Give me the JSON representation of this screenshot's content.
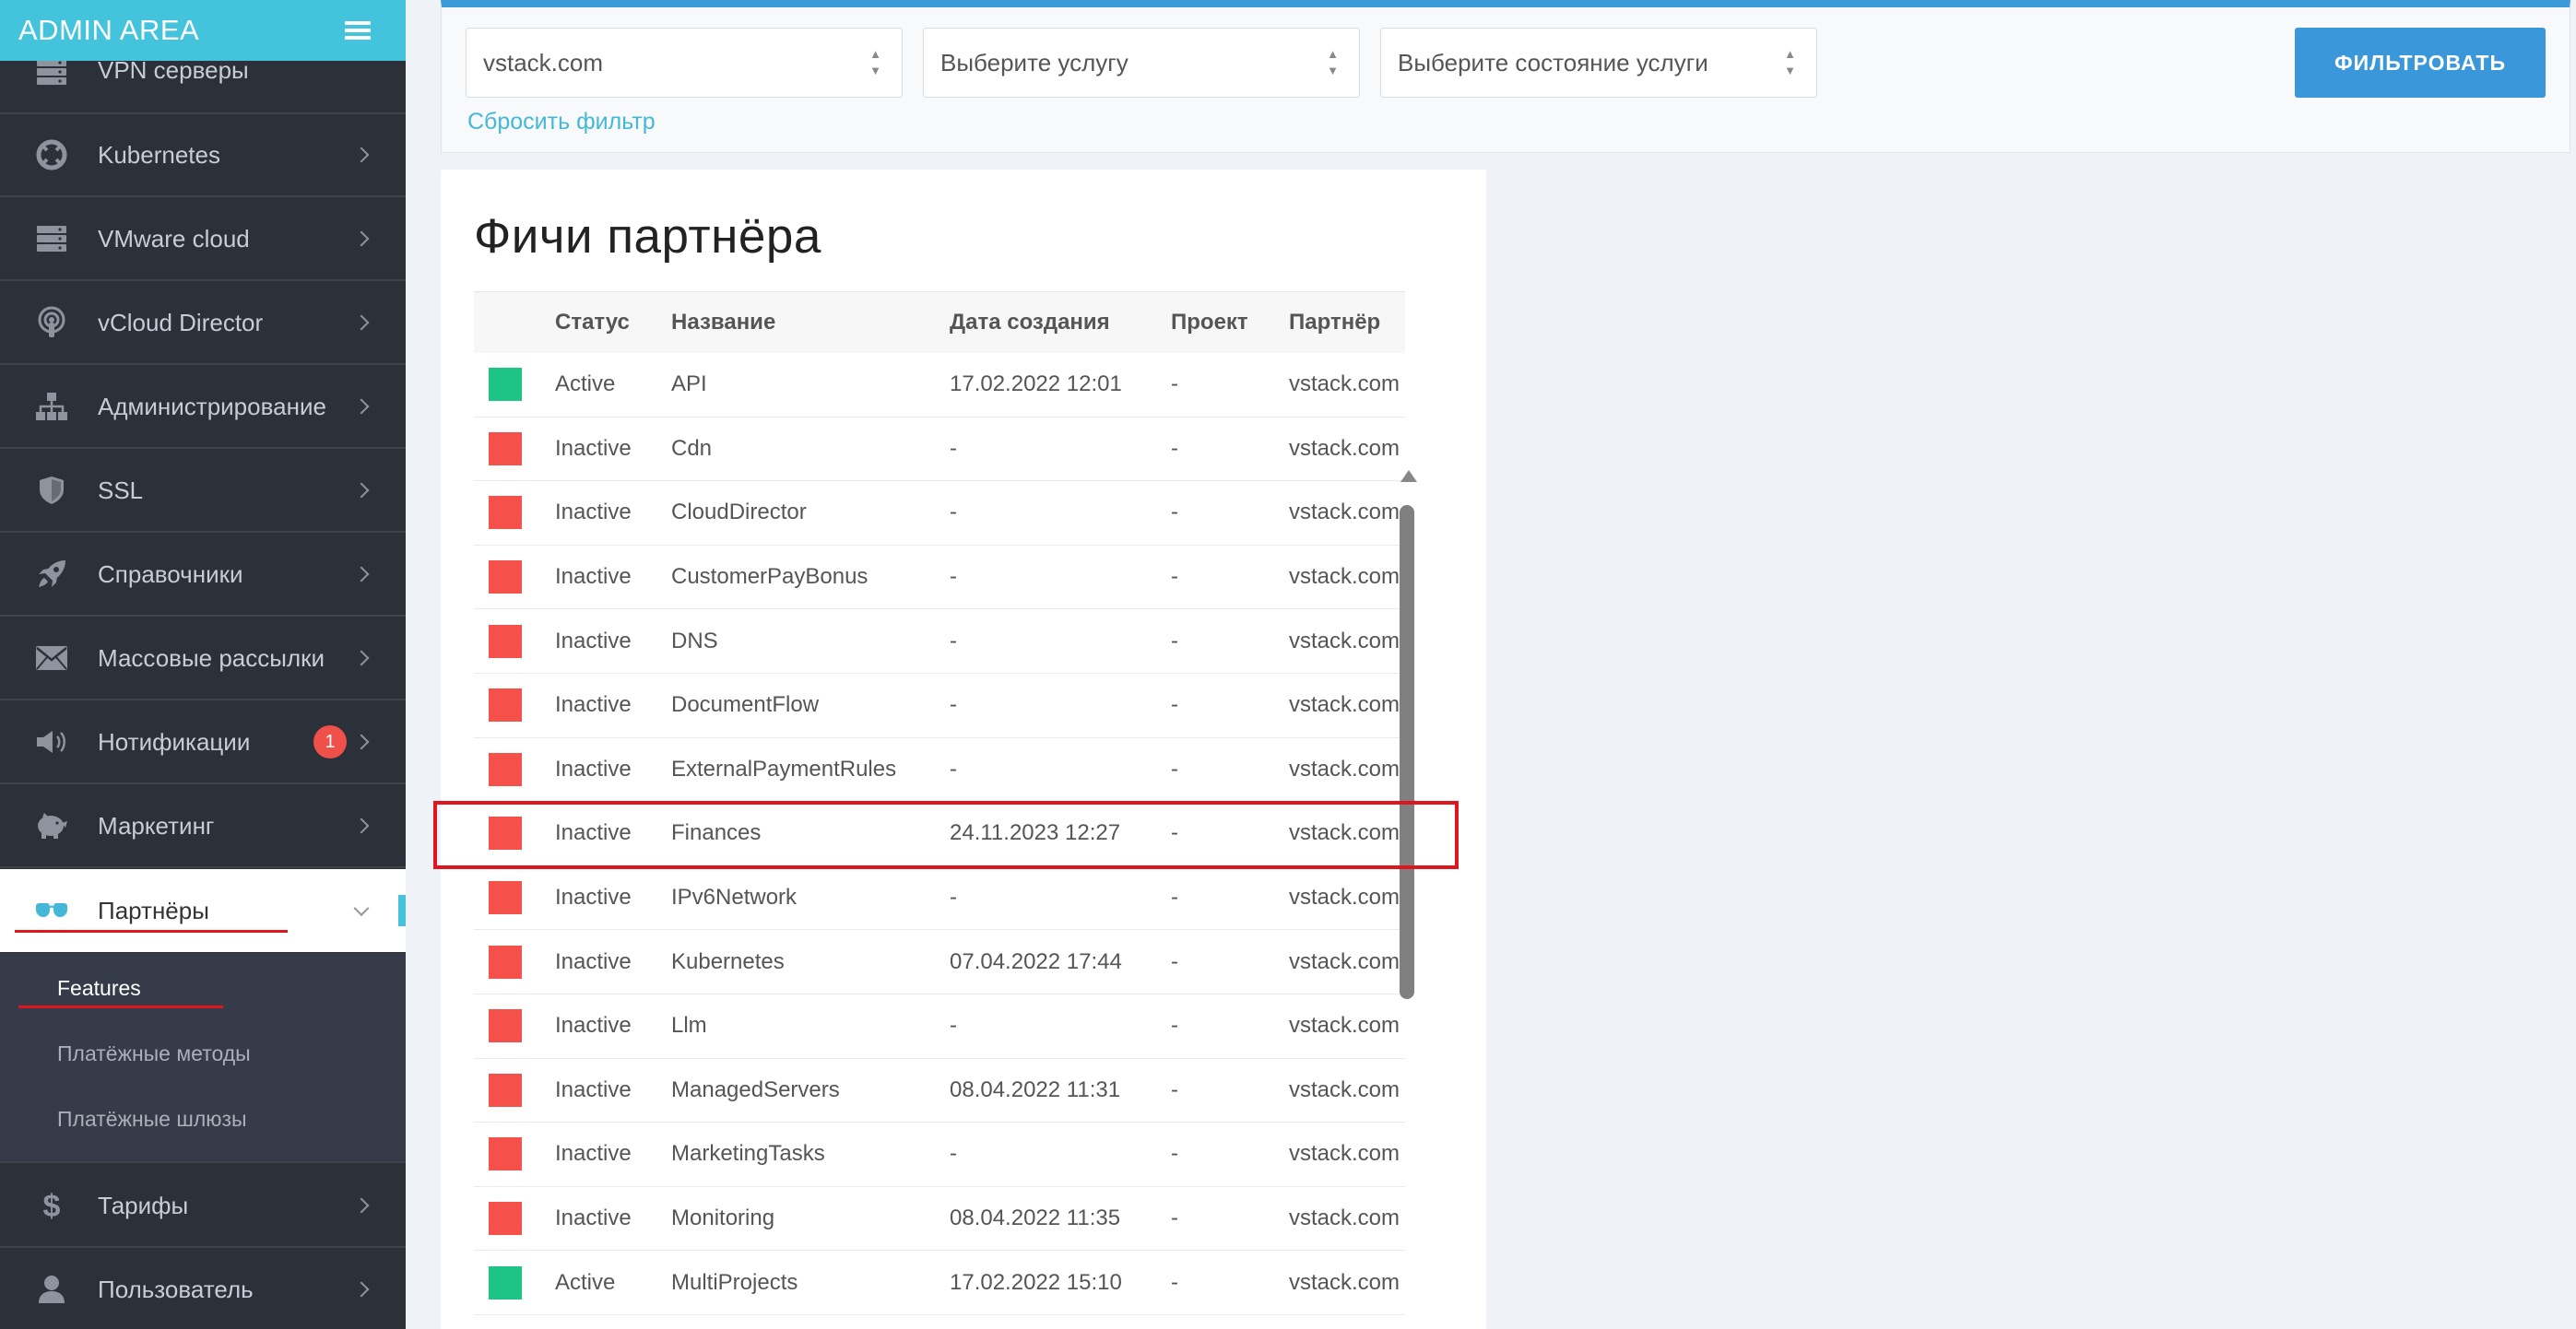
{
  "sidebar": {
    "brand": "ADMIN AREA",
    "items": [
      {
        "label": "VPN серверы",
        "icon": "server-icon"
      },
      {
        "label": "Kubernetes",
        "icon": "lifebuoy-icon"
      },
      {
        "label": "VMware cloud",
        "icon": "server-icon"
      },
      {
        "label": "vCloud Director",
        "icon": "podcast-icon"
      },
      {
        "label": "Администрирование",
        "icon": "sitemap-icon"
      },
      {
        "label": "SSL",
        "icon": "shield-icon"
      },
      {
        "label": "Справочники",
        "icon": "rocket-icon"
      },
      {
        "label": "Массовые рассылки",
        "icon": "envelope-icon"
      },
      {
        "label": "Нотификации",
        "icon": "megaphone-icon",
        "badge": "1"
      },
      {
        "label": "Маркетинг",
        "icon": "piggy-bank-icon"
      },
      {
        "label": "Партнёры",
        "icon": "glasses-icon"
      },
      {
        "label": "Тарифы",
        "icon": "dollar-icon"
      },
      {
        "label": "Пользователь",
        "icon": "user-icon"
      }
    ],
    "submenu": [
      {
        "label": "Features",
        "active": true
      },
      {
        "label": "Платёжные методы",
        "active": false
      },
      {
        "label": "Платёжные шлюзы",
        "active": false
      }
    ]
  },
  "filters": {
    "partner_value": "vstack.com",
    "service_placeholder": "Выберите услугу",
    "state_placeholder": "Выберите состояние услуги",
    "filter_button": "ФИЛЬТРОВАТЬ",
    "reset_link": "Сбросить фильтр"
  },
  "page": {
    "title": "Фичи партнёра"
  },
  "colors": {
    "active": "#1ec486",
    "inactive": "#f5504a",
    "accent": "#3a97da",
    "brand": "#44c4dc"
  },
  "table": {
    "headers": [
      "",
      "Статус",
      "Название",
      "Дата создания",
      "Проект",
      "Партнёр"
    ],
    "rows": [
      {
        "status": "Active",
        "name": "API",
        "created": "17.02.2022 12:01",
        "project": "-",
        "partner": "vstack.com"
      },
      {
        "status": "Inactive",
        "name": "Cdn",
        "created": "-",
        "project": "-",
        "partner": "vstack.com"
      },
      {
        "status": "Inactive",
        "name": "CloudDirector",
        "created": "-",
        "project": "-",
        "partner": "vstack.com"
      },
      {
        "status": "Inactive",
        "name": "CustomerPayBonus",
        "created": "-",
        "project": "-",
        "partner": "vstack.com"
      },
      {
        "status": "Inactive",
        "name": "DNS",
        "created": "-",
        "project": "-",
        "partner": "vstack.com"
      },
      {
        "status": "Inactive",
        "name": "DocumentFlow",
        "created": "-",
        "project": "-",
        "partner": "vstack.com"
      },
      {
        "status": "Inactive",
        "name": "ExternalPaymentRules",
        "created": "-",
        "project": "-",
        "partner": "vstack.com"
      },
      {
        "status": "Inactive",
        "name": "Finances",
        "created": "24.11.2023 12:27",
        "project": "-",
        "partner": "vstack.com",
        "highlighted": true
      },
      {
        "status": "Inactive",
        "name": "IPv6Network",
        "created": "-",
        "project": "-",
        "partner": "vstack.com"
      },
      {
        "status": "Inactive",
        "name": "Kubernetes",
        "created": "07.04.2022 17:44",
        "project": "-",
        "partner": "vstack.com"
      },
      {
        "status": "Inactive",
        "name": "Llm",
        "created": "-",
        "project": "-",
        "partner": "vstack.com"
      },
      {
        "status": "Inactive",
        "name": "ManagedServers",
        "created": "08.04.2022 11:31",
        "project": "-",
        "partner": "vstack.com"
      },
      {
        "status": "Inactive",
        "name": "MarketingTasks",
        "created": "-",
        "project": "-",
        "partner": "vstack.com"
      },
      {
        "status": "Inactive",
        "name": "Monitoring",
        "created": "08.04.2022 11:35",
        "project": "-",
        "partner": "vstack.com"
      },
      {
        "status": "Active",
        "name": "MultiProjects",
        "created": "17.02.2022 15:10",
        "project": "-",
        "partner": "vstack.com"
      }
    ]
  }
}
